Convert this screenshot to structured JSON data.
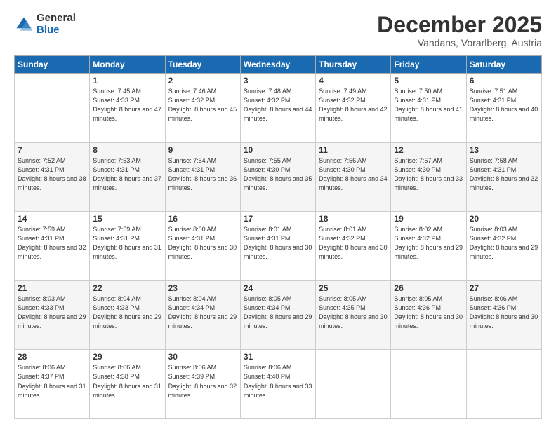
{
  "logo": {
    "general": "General",
    "blue": "Blue"
  },
  "header": {
    "month": "December 2025",
    "location": "Vandans, Vorarlberg, Austria"
  },
  "weekdays": [
    "Sunday",
    "Monday",
    "Tuesday",
    "Wednesday",
    "Thursday",
    "Friday",
    "Saturday"
  ],
  "weeks": [
    [
      {
        "day": "",
        "sunrise": "",
        "sunset": "",
        "daylight": ""
      },
      {
        "day": "1",
        "sunrise": "Sunrise: 7:45 AM",
        "sunset": "Sunset: 4:33 PM",
        "daylight": "Daylight: 8 hours and 47 minutes."
      },
      {
        "day": "2",
        "sunrise": "Sunrise: 7:46 AM",
        "sunset": "Sunset: 4:32 PM",
        "daylight": "Daylight: 8 hours and 45 minutes."
      },
      {
        "day": "3",
        "sunrise": "Sunrise: 7:48 AM",
        "sunset": "Sunset: 4:32 PM",
        "daylight": "Daylight: 8 hours and 44 minutes."
      },
      {
        "day": "4",
        "sunrise": "Sunrise: 7:49 AM",
        "sunset": "Sunset: 4:32 PM",
        "daylight": "Daylight: 8 hours and 42 minutes."
      },
      {
        "day": "5",
        "sunrise": "Sunrise: 7:50 AM",
        "sunset": "Sunset: 4:31 PM",
        "daylight": "Daylight: 8 hours and 41 minutes."
      },
      {
        "day": "6",
        "sunrise": "Sunrise: 7:51 AM",
        "sunset": "Sunset: 4:31 PM",
        "daylight": "Daylight: 8 hours and 40 minutes."
      }
    ],
    [
      {
        "day": "7",
        "sunrise": "Sunrise: 7:52 AM",
        "sunset": "Sunset: 4:31 PM",
        "daylight": "Daylight: 8 hours and 38 minutes."
      },
      {
        "day": "8",
        "sunrise": "Sunrise: 7:53 AM",
        "sunset": "Sunset: 4:31 PM",
        "daylight": "Daylight: 8 hours and 37 minutes."
      },
      {
        "day": "9",
        "sunrise": "Sunrise: 7:54 AM",
        "sunset": "Sunset: 4:31 PM",
        "daylight": "Daylight: 8 hours and 36 minutes."
      },
      {
        "day": "10",
        "sunrise": "Sunrise: 7:55 AM",
        "sunset": "Sunset: 4:30 PM",
        "daylight": "Daylight: 8 hours and 35 minutes."
      },
      {
        "day": "11",
        "sunrise": "Sunrise: 7:56 AM",
        "sunset": "Sunset: 4:30 PM",
        "daylight": "Daylight: 8 hours and 34 minutes."
      },
      {
        "day": "12",
        "sunrise": "Sunrise: 7:57 AM",
        "sunset": "Sunset: 4:30 PM",
        "daylight": "Daylight: 8 hours and 33 minutes."
      },
      {
        "day": "13",
        "sunrise": "Sunrise: 7:58 AM",
        "sunset": "Sunset: 4:31 PM",
        "daylight": "Daylight: 8 hours and 32 minutes."
      }
    ],
    [
      {
        "day": "14",
        "sunrise": "Sunrise: 7:59 AM",
        "sunset": "Sunset: 4:31 PM",
        "daylight": "Daylight: 8 hours and 32 minutes."
      },
      {
        "day": "15",
        "sunrise": "Sunrise: 7:59 AM",
        "sunset": "Sunset: 4:31 PM",
        "daylight": "Daylight: 8 hours and 31 minutes."
      },
      {
        "day": "16",
        "sunrise": "Sunrise: 8:00 AM",
        "sunset": "Sunset: 4:31 PM",
        "daylight": "Daylight: 8 hours and 30 minutes."
      },
      {
        "day": "17",
        "sunrise": "Sunrise: 8:01 AM",
        "sunset": "Sunset: 4:31 PM",
        "daylight": "Daylight: 8 hours and 30 minutes."
      },
      {
        "day": "18",
        "sunrise": "Sunrise: 8:01 AM",
        "sunset": "Sunset: 4:32 PM",
        "daylight": "Daylight: 8 hours and 30 minutes."
      },
      {
        "day": "19",
        "sunrise": "Sunrise: 8:02 AM",
        "sunset": "Sunset: 4:32 PM",
        "daylight": "Daylight: 8 hours and 29 minutes."
      },
      {
        "day": "20",
        "sunrise": "Sunrise: 8:03 AM",
        "sunset": "Sunset: 4:32 PM",
        "daylight": "Daylight: 8 hours and 29 minutes."
      }
    ],
    [
      {
        "day": "21",
        "sunrise": "Sunrise: 8:03 AM",
        "sunset": "Sunset: 4:33 PM",
        "daylight": "Daylight: 8 hours and 29 minutes."
      },
      {
        "day": "22",
        "sunrise": "Sunrise: 8:04 AM",
        "sunset": "Sunset: 4:33 PM",
        "daylight": "Daylight: 8 hours and 29 minutes."
      },
      {
        "day": "23",
        "sunrise": "Sunrise: 8:04 AM",
        "sunset": "Sunset: 4:34 PM",
        "daylight": "Daylight: 8 hours and 29 minutes."
      },
      {
        "day": "24",
        "sunrise": "Sunrise: 8:05 AM",
        "sunset": "Sunset: 4:34 PM",
        "daylight": "Daylight: 8 hours and 29 minutes."
      },
      {
        "day": "25",
        "sunrise": "Sunrise: 8:05 AM",
        "sunset": "Sunset: 4:35 PM",
        "daylight": "Daylight: 8 hours and 30 minutes."
      },
      {
        "day": "26",
        "sunrise": "Sunrise: 8:05 AM",
        "sunset": "Sunset: 4:36 PM",
        "daylight": "Daylight: 8 hours and 30 minutes."
      },
      {
        "day": "27",
        "sunrise": "Sunrise: 8:06 AM",
        "sunset": "Sunset: 4:36 PM",
        "daylight": "Daylight: 8 hours and 30 minutes."
      }
    ],
    [
      {
        "day": "28",
        "sunrise": "Sunrise: 8:06 AM",
        "sunset": "Sunset: 4:37 PM",
        "daylight": "Daylight: 8 hours and 31 minutes."
      },
      {
        "day": "29",
        "sunrise": "Sunrise: 8:06 AM",
        "sunset": "Sunset: 4:38 PM",
        "daylight": "Daylight: 8 hours and 31 minutes."
      },
      {
        "day": "30",
        "sunrise": "Sunrise: 8:06 AM",
        "sunset": "Sunset: 4:39 PM",
        "daylight": "Daylight: 8 hours and 32 minutes."
      },
      {
        "day": "31",
        "sunrise": "Sunrise: 8:06 AM",
        "sunset": "Sunset: 4:40 PM",
        "daylight": "Daylight: 8 hours and 33 minutes."
      },
      {
        "day": "",
        "sunrise": "",
        "sunset": "",
        "daylight": ""
      },
      {
        "day": "",
        "sunrise": "",
        "sunset": "",
        "daylight": ""
      },
      {
        "day": "",
        "sunrise": "",
        "sunset": "",
        "daylight": ""
      }
    ]
  ]
}
